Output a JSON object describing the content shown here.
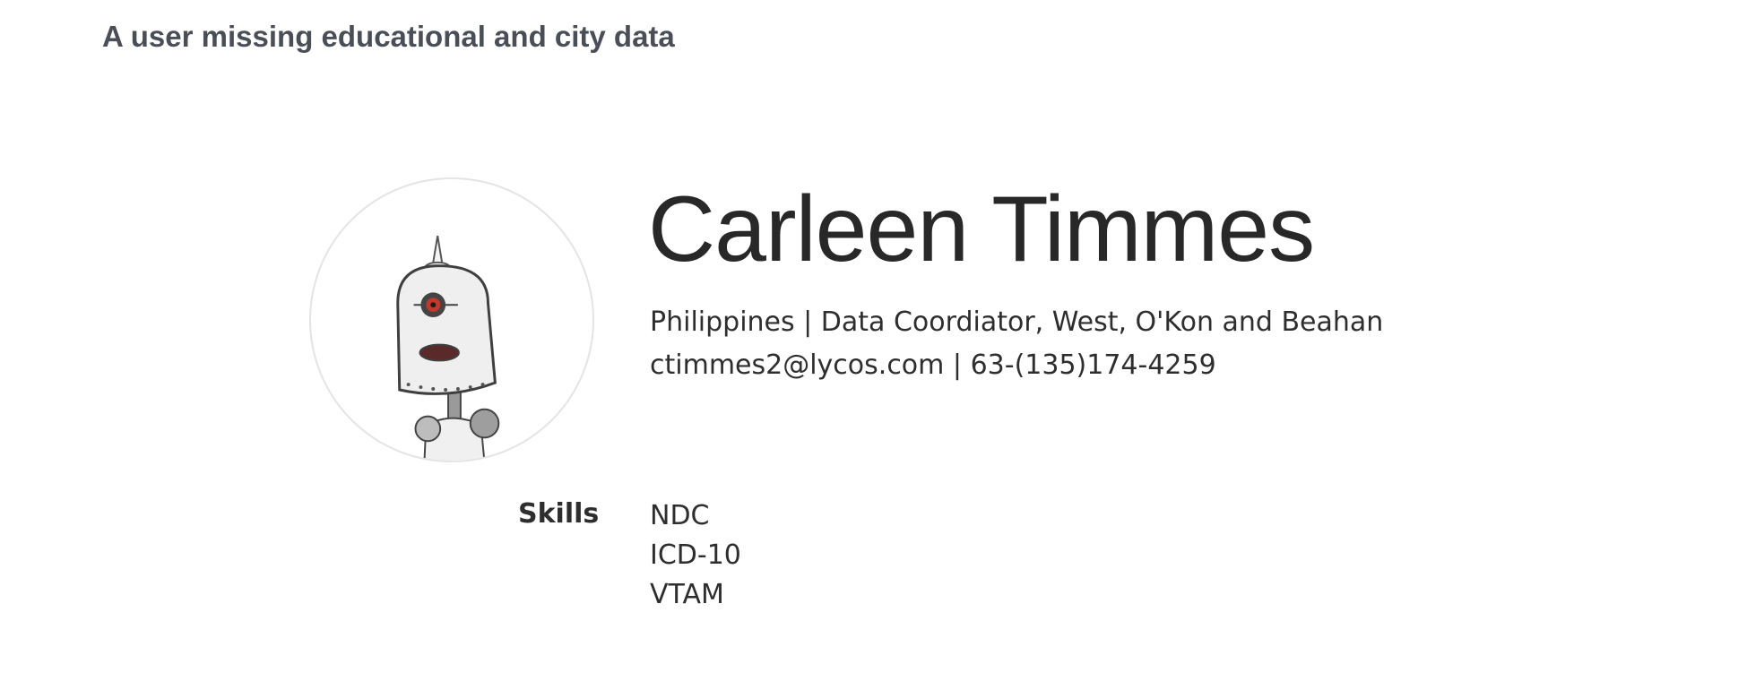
{
  "example": {
    "title": "A user missing educational and city data"
  },
  "profile": {
    "avatar_icon": "robot-avatar-icon",
    "name": "Carleen Timmes",
    "details_line": "Philippines | Data Coordiator, West, O'Kon and Beahan",
    "contact_line": "ctimmes2@lycos.com | 63-(135)174-4259"
  },
  "skills": {
    "label": "Skills",
    "items": [
      "NDC",
      "ICD-10",
      "VTAM"
    ]
  }
}
